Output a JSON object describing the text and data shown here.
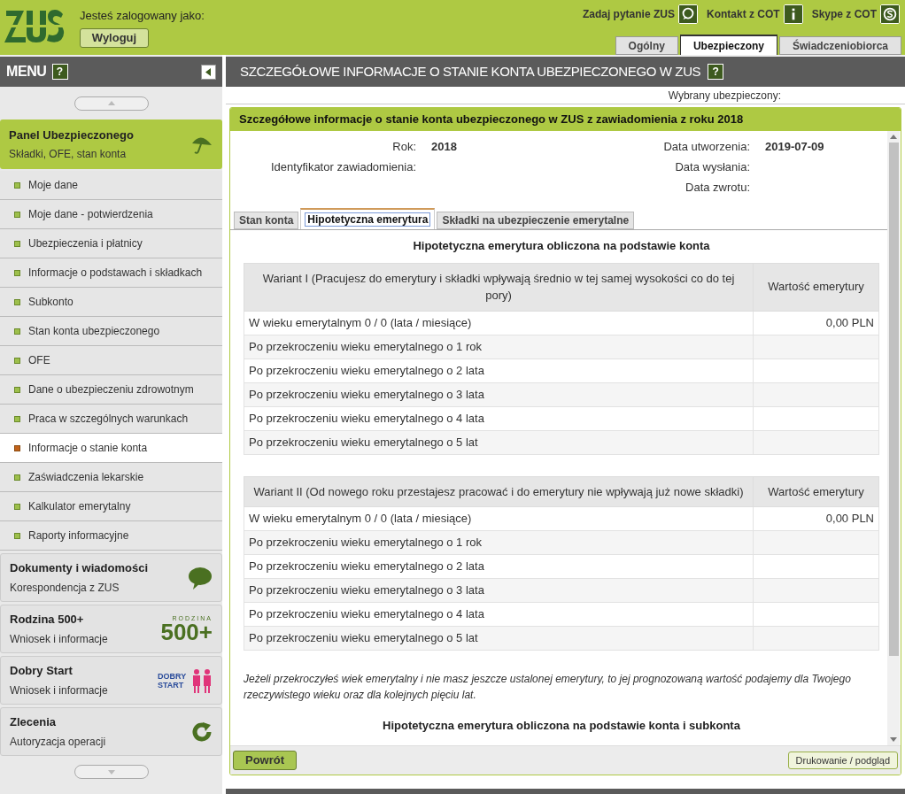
{
  "header": {
    "logged_in_label": "Jesteś zalogowany jako:",
    "logout_button": "Wyloguj",
    "links": [
      {
        "label": "Zadaj pytanie ZUS",
        "kind": "question"
      },
      {
        "label": "Kontakt z COT",
        "kind": "info"
      },
      {
        "label": "Skype z COT",
        "kind": "skype"
      }
    ],
    "tabs": [
      {
        "label": "Ogólny",
        "selected": false
      },
      {
        "label": "Ubezpieczony",
        "selected": true
      },
      {
        "label": "Świadczeniobiorca",
        "selected": false
      }
    ]
  },
  "sidebar": {
    "title": "MENU",
    "help": "?",
    "panel": {
      "title": "Panel Ubezpieczonego",
      "subtitle": "Składki, OFE, stan konta"
    },
    "items": [
      {
        "label": "Moje dane",
        "selected": false
      },
      {
        "label": "Moje dane - potwierdzenia",
        "selected": false
      },
      {
        "label": "Ubezpieczenia i płatnicy",
        "selected": false
      },
      {
        "label": "Informacje o podstawach i składkach",
        "selected": false
      },
      {
        "label": "Subkonto",
        "selected": false
      },
      {
        "label": "Stan konta ubezpieczonego",
        "selected": false
      },
      {
        "label": "OFE",
        "selected": false
      },
      {
        "label": "Dane o ubezpieczeniu zdrowotnym",
        "selected": false
      },
      {
        "label": "Praca w szczególnych warunkach",
        "selected": false
      },
      {
        "label": "Informacje o stanie konta",
        "selected": true
      },
      {
        "label": "Zaświadczenia lekarskie",
        "selected": false
      },
      {
        "label": "Kalkulator emerytalny",
        "selected": false
      },
      {
        "label": "Raporty informacyjne",
        "selected": false
      }
    ],
    "sections": [
      {
        "title": "Dokumenty i wiadomości",
        "subtitle": "Korespondencja z ZUS",
        "kind": "chat"
      },
      {
        "title": "Rodzina 500+",
        "subtitle": "Wniosek i informacje",
        "kind": "rodzina",
        "logo_text": "RODZINA",
        "logo_number": "500+"
      },
      {
        "title": "Dobry Start",
        "subtitle": "Wniosek i informacje",
        "kind": "dobry",
        "logo_text": "DOBRY START"
      },
      {
        "title": "Zlecenia",
        "subtitle": "Autoryzacja operacji",
        "kind": "refresh"
      }
    ]
  },
  "main": {
    "title": "SZCZEGÓŁOWE INFORMACJE O STANIE KONTA UBEZPIECZONEGO W ZUS",
    "help": "?",
    "selected_insured_label": "Wybrany ubezpieczony:",
    "panel_title": "Szczegółowe informacje o stanie konta ubezpieczonego w ZUS z zawiadomienia z roku 2018",
    "info_left": [
      {
        "label": "Rok:",
        "value": "2018"
      },
      {
        "label": "Identyfikator zawiadomienia:"
      }
    ],
    "info_right": [
      {
        "label": "Data utworzenia:",
        "value": "2019-07-09"
      },
      {
        "label": "Data wysłania:"
      },
      {
        "label": "Data zwrotu:"
      }
    ],
    "tabs": [
      {
        "label": "Stan konta",
        "selected": false
      },
      {
        "label": "Hipotetyczna emerytura",
        "selected": true
      },
      {
        "label": "Składki na ubezpieczenie emerytalne",
        "selected": false
      }
    ],
    "section_title": "Hipotetyczna emerytura obliczona na podstawie konta",
    "tables": [
      {
        "columns": [
          "Wariant I (Pracujesz do emerytury i składki wpływają średnio w tej samej wysokości co do tej pory)",
          "Wartość emerytury"
        ],
        "rows": [
          [
            "W wieku emerytalnym 0 / 0 (lata / miesiące)",
            "0,00 PLN"
          ],
          [
            "Po przekroczeniu wieku emerytalnego o 1 rok"
          ],
          [
            "Po przekroczeniu wieku emerytalnego o 2 lata"
          ],
          [
            "Po przekroczeniu wieku emerytalnego o 3 lata"
          ],
          [
            "Po przekroczeniu wieku emerytalnego o 4 lata"
          ],
          [
            "Po przekroczeniu wieku emerytalnego o 5 lat"
          ]
        ]
      },
      {
        "columns": [
          "Wariant II (Od nowego roku przestajesz pracować i do emerytury nie wpływają już nowe składki)",
          "Wartość emerytury"
        ],
        "rows": [
          [
            "W wieku emerytalnym 0 / 0 (lata / miesiące)",
            "0,00 PLN"
          ],
          [
            "Po przekroczeniu wieku emerytalnego o 1 rok"
          ],
          [
            "Po przekroczeniu wieku emerytalnego o 2 lata"
          ],
          [
            "Po przekroczeniu wieku emerytalnego o 3 lata"
          ],
          [
            "Po przekroczeniu wieku emerytalnego o 4 lata"
          ],
          [
            "Po przekroczeniu wieku emerytalnego o 5 lat"
          ]
        ]
      }
    ],
    "note": "Jeżeli przekroczyłeś wiek emerytalny i nie masz jeszcze ustalonej emerytury, to jej prognozowaną wartość podajemy dla Twojego rzeczywistego wieku oraz dla kolejnych pięciu lat.",
    "section2_title": "Hipotetyczna emerytura obliczona na podstawie konta i subkonta",
    "back_button": "Powrót",
    "print_button": "Drukowanie / podgląd"
  }
}
